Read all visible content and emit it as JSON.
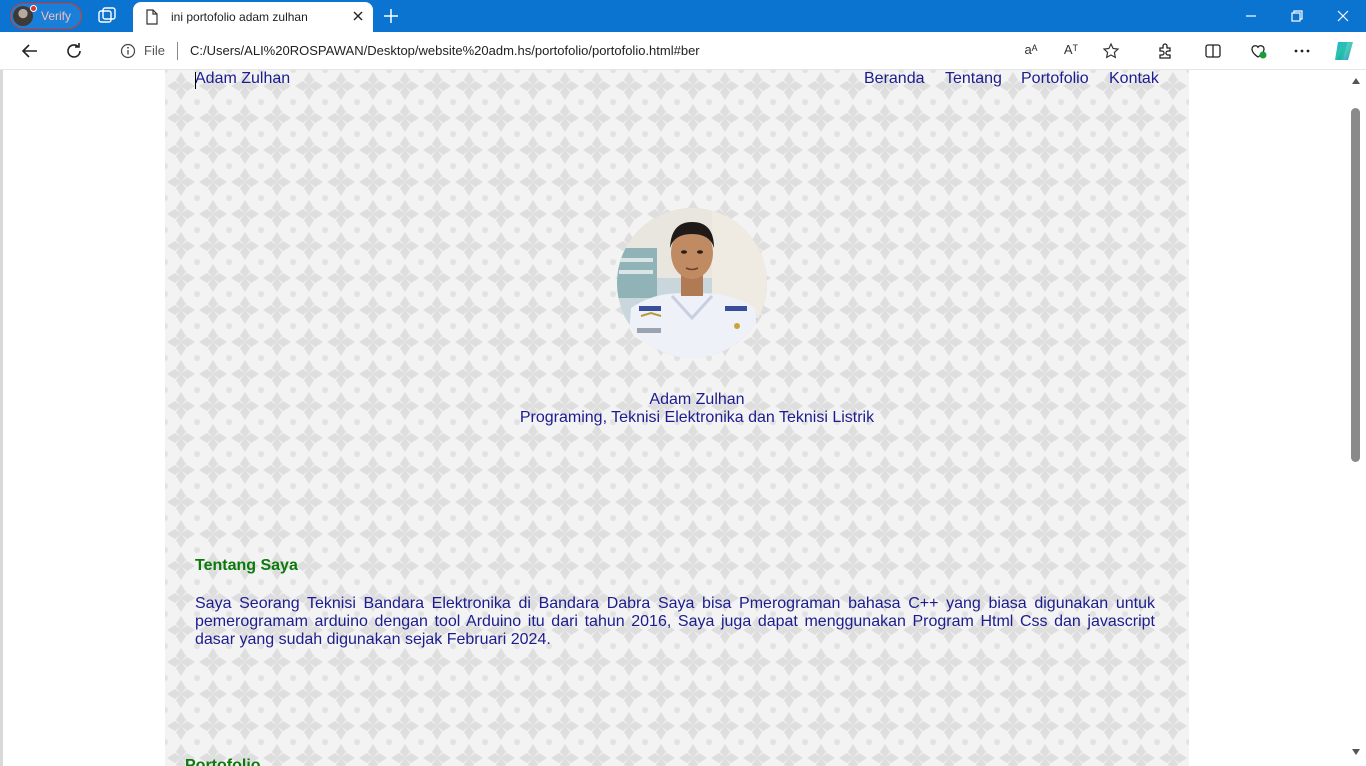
{
  "browser": {
    "profile_label": "Verify",
    "tab_title": "ini portofolio adam zulhan",
    "url_scheme_label": "File",
    "url": "C:/Users/ALI%20ROSPAWAN/Desktop/website%20adm.hs/portofolio/portofolio.html#ber",
    "read_aloud_label": "Aᵀ",
    "translate_label": "aᴬ",
    "accent": "#0b74d1"
  },
  "site": {
    "brand": "Adam Zulhan",
    "nav": [
      {
        "label": "Beranda"
      },
      {
        "label": "Tentang"
      },
      {
        "label": "Portofolio"
      },
      {
        "label": "Kontak"
      }
    ],
    "hero": {
      "name": "Adam Zulhan",
      "subtitle": "Programing, Teknisi Elektronika dan Teknisi Listrik"
    },
    "about": {
      "heading": "Tentang Saya",
      "body": "Saya Seorang Teknisi Bandara Elektronika di Bandara Dabra Saya bisa Pmerograman bahasa C++ yang biasa digunakan untuk pemerogramam arduino dengan tool Arduino itu dari tahun 2016, Saya juga dapat menggunakan Program Html Css dan javascript dasar yang sudah digunakan sejak Februari 2024."
    },
    "portfolio": {
      "heading": "Portofolio"
    },
    "colors": {
      "link": "#1c1c8f",
      "heading": "#0b7a0b",
      "background": "#f2f2f2"
    }
  }
}
